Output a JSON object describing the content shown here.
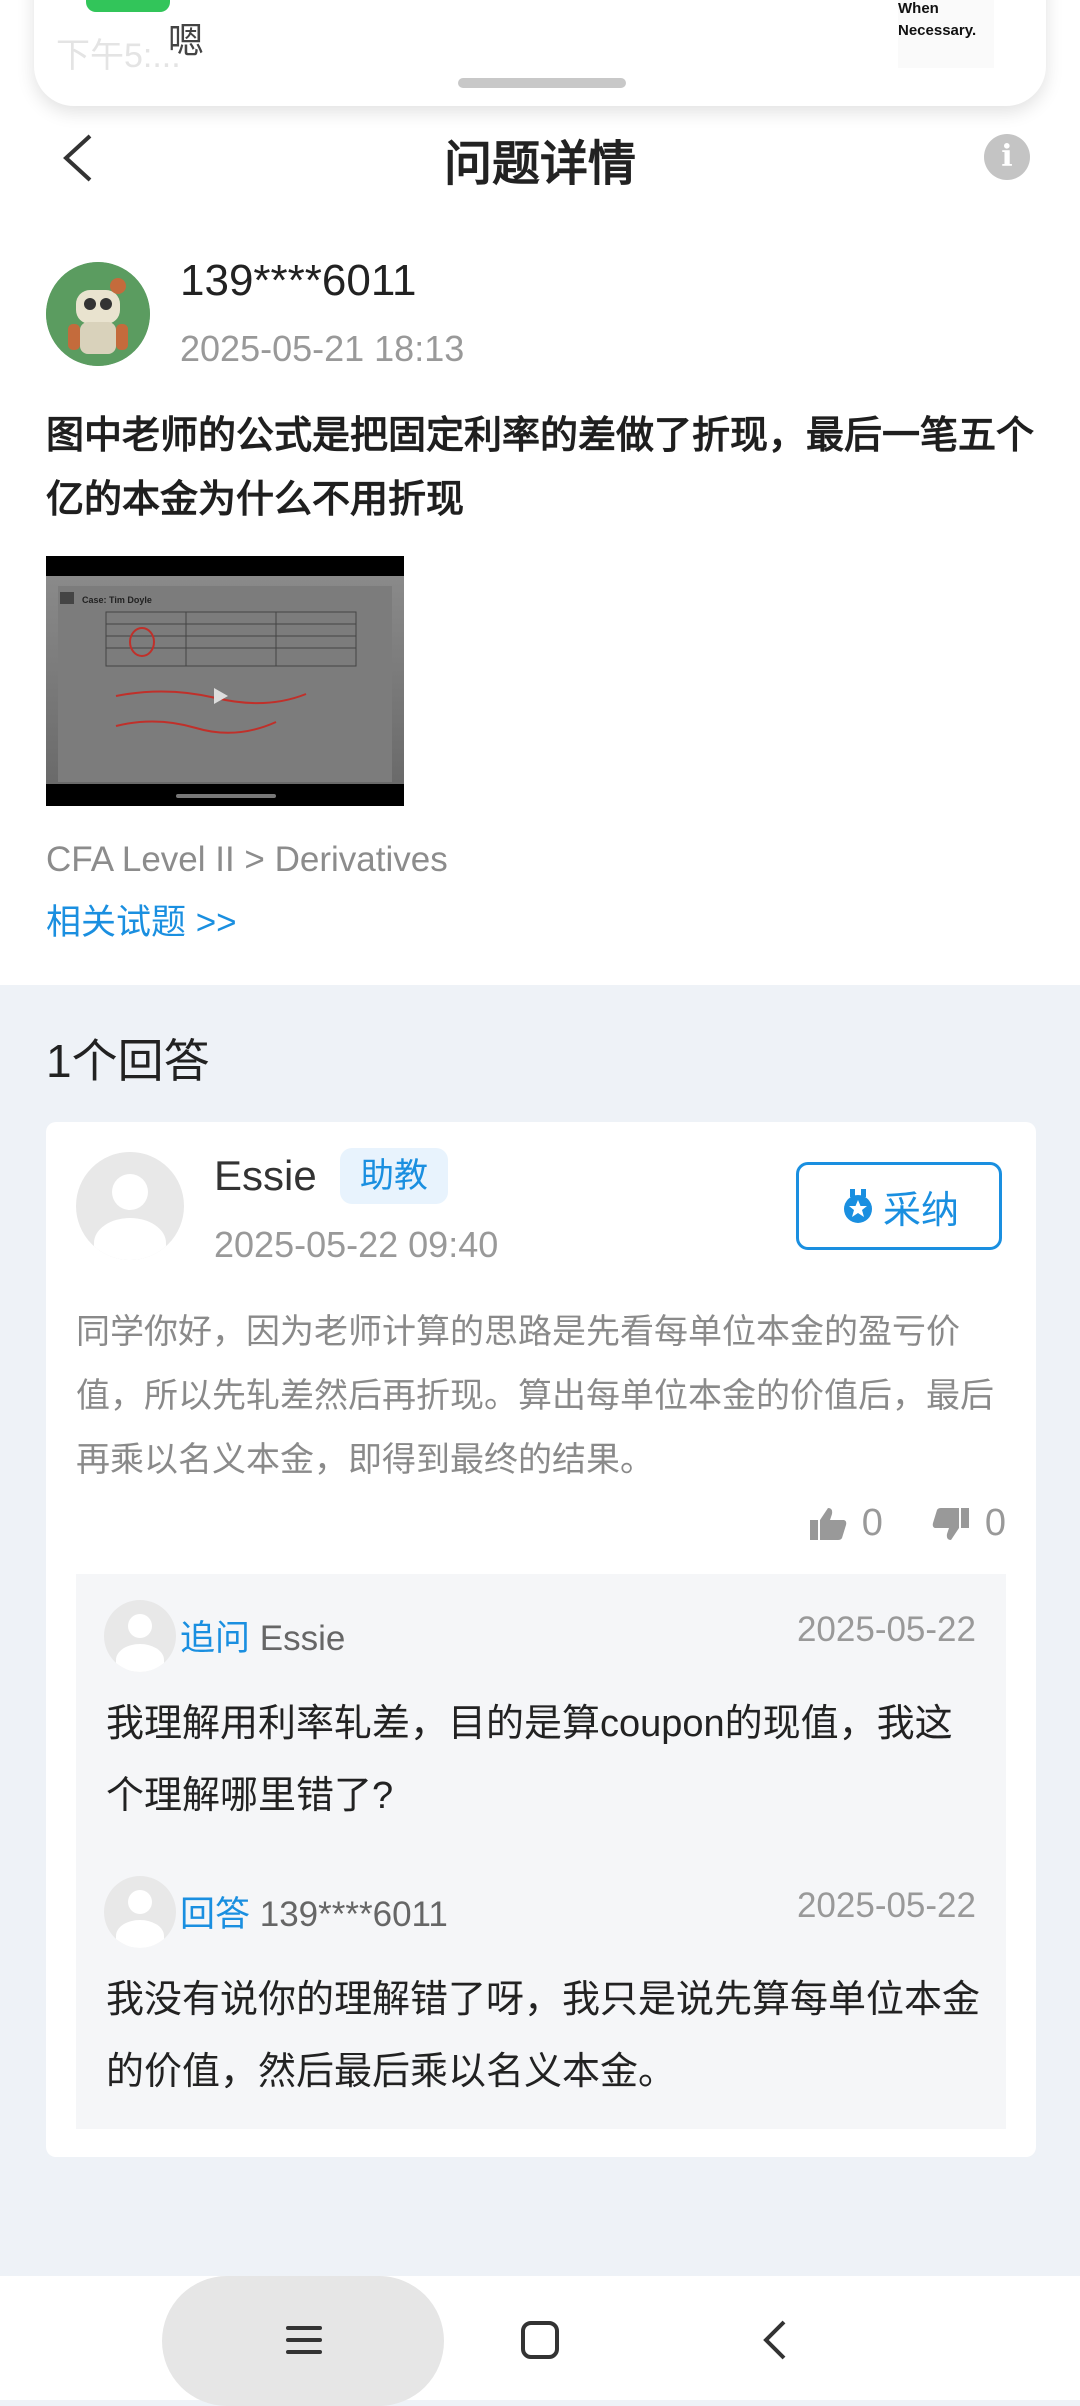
{
  "notification": {
    "reply_text": "嗯",
    "thumb_text": "When Necessary."
  },
  "status_bar": {
    "time": "下午5:..."
  },
  "header": {
    "title": "问题详情"
  },
  "question": {
    "username": "139****6011",
    "time": "2025-05-21 18:13",
    "text": "图中老师的公式是把固定利率的差做了折现，最后一笔五个亿的本金为什么不用折现",
    "image_caption": "Case: Tim Doyle",
    "category": "CFA Level II > Derivatives",
    "related_link": "相关试题 >>"
  },
  "answers": {
    "count_label": "1个回答",
    "items": [
      {
        "name": "Essie",
        "badge": "助教",
        "time": "2025-05-22 09:40",
        "adopt_label": "采纳",
        "text": "同学你好，因为老师计算的思路是先看每单位本金的盈亏价值，所以先轧差然后再折现。算出每单位本金的价值后，最后再乘以名义本金，即得到最终的结果。",
        "likes": "0",
        "dislikes": "0",
        "followups": [
          {
            "kind": "追问",
            "who": "Essie",
            "date": "2025-05-22",
            "text": "我理解用利率轧差，目的是算coupon的现值，我这个理解哪里错了?"
          },
          {
            "kind": "回答",
            "who": "139****6011",
            "date": "2025-05-22",
            "text": "我没有说你的理解错了呀，我只是说先算每单位本金的价值，然后最后乘以名义本金。"
          }
        ]
      }
    ]
  },
  "colors": {
    "accent": "#1a8fe0",
    "page_bg": "#eef2f7",
    "notification_green": "#32c55a"
  }
}
